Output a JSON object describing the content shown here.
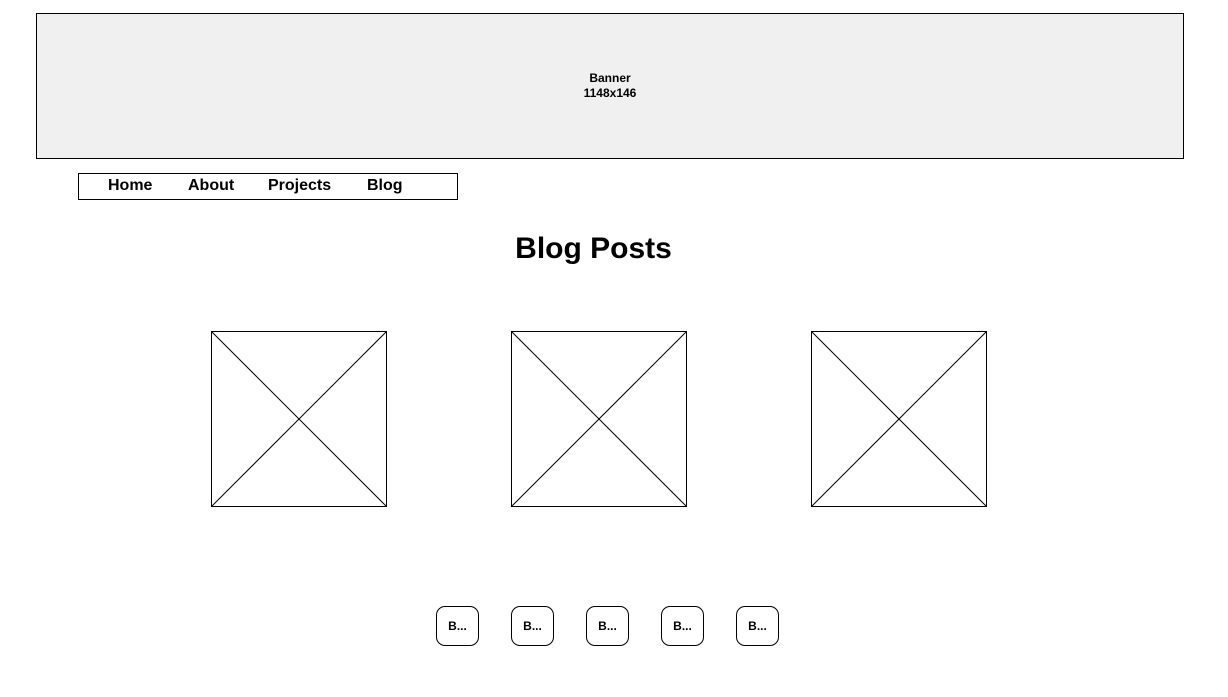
{
  "banner": {
    "title": "Banner",
    "size": "1148x146"
  },
  "nav": {
    "items": [
      {
        "label": "Home"
      },
      {
        "label": "About"
      },
      {
        "label": "Projects"
      },
      {
        "label": "Blog"
      }
    ]
  },
  "page": {
    "title": "Blog Posts"
  },
  "pagination": {
    "buttons": [
      {
        "label": "B..."
      },
      {
        "label": "B..."
      },
      {
        "label": "B..."
      },
      {
        "label": "B..."
      },
      {
        "label": "B..."
      }
    ]
  }
}
